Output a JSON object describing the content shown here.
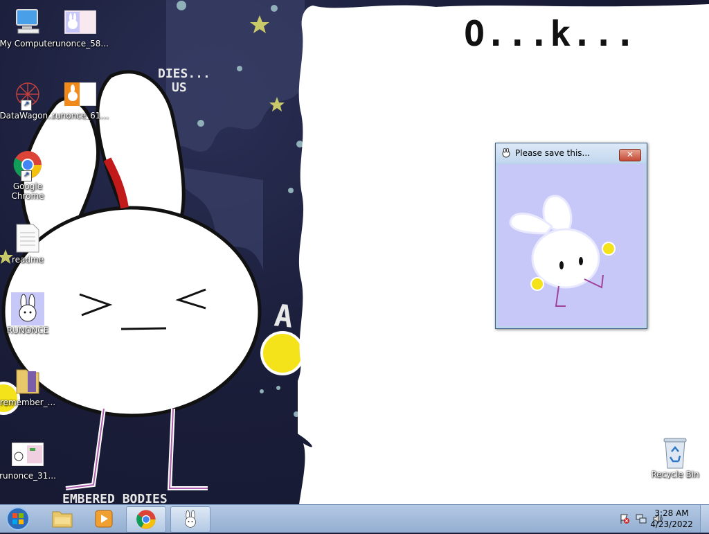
{
  "desktop": {
    "icons": [
      {
        "label": "My Computer",
        "icon": "computer-icon"
      },
      {
        "label": "runonce_58...",
        "icon": "image-thumbnail-icon"
      },
      {
        "label": "DataWagon...",
        "icon": "datawagon-shortcut-icon"
      },
      {
        "label": "runonce_61...",
        "icon": "image-thumbnail-icon"
      },
      {
        "label": "Google Chrome",
        "icon": "chrome-icon"
      },
      {
        "label": "readme",
        "icon": "text-file-icon"
      },
      {
        "label": "RUNONCE",
        "icon": "runonce-app-icon"
      },
      {
        "label": "remember_...",
        "icon": "folder-icon"
      },
      {
        "label": "runonce_31...",
        "icon": "image-thumbnail-icon"
      },
      {
        "label": "Recycle Bin",
        "icon": "recycle-bin-icon"
      }
    ],
    "speech_text": "O...k..."
  },
  "popup": {
    "title": "Please save this...",
    "close_label": "✕",
    "image": "bunny-illustration"
  },
  "taskbar": {
    "start_icon": "windows-start-icon",
    "pinned": [
      {
        "name": "explorer",
        "icon": "folder-icon"
      },
      {
        "name": "media-player",
        "icon": "media-player-icon"
      },
      {
        "name": "chrome",
        "icon": "chrome-icon"
      },
      {
        "name": "runonce",
        "icon": "runonce-app-icon"
      }
    ],
    "tray_icons": [
      "action-center-flag-icon",
      "network-icon",
      "volume-icon"
    ],
    "time": "3:28 AM",
    "date": "4/23/2022"
  },
  "colors": {
    "taskbar": "#a9c0de",
    "popup_bg": "#c8c8f8",
    "desktop_bg": "#1c1f3a"
  }
}
